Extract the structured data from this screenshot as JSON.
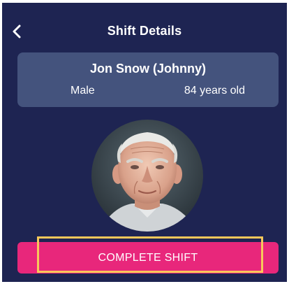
{
  "header": {
    "title": "Shift Details",
    "back_icon": "chevron-left-icon"
  },
  "patient": {
    "name": "Jon Snow (Johnny)",
    "gender": "Male",
    "age": "84 years old"
  },
  "actions": {
    "complete_label": "COMPLETE SHIFT"
  },
  "colors": {
    "background": "#1e2452",
    "card": "#44537d",
    "button": "#e8277b",
    "highlight": "#f7c85a",
    "text": "#ffffff"
  }
}
